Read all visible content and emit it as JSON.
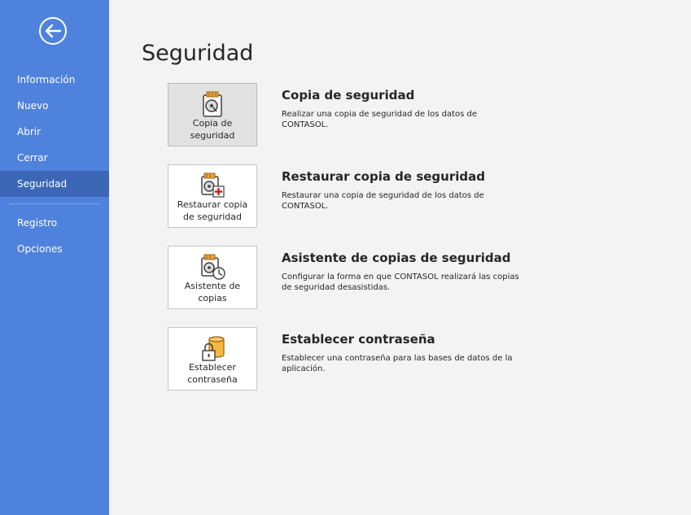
{
  "sidebar": {
    "back_icon": "back-arrow-icon",
    "items": [
      {
        "label": "Información"
      },
      {
        "label": "Nuevo"
      },
      {
        "label": "Abrir"
      },
      {
        "label": "Cerrar"
      },
      {
        "label": "Seguridad",
        "active": true
      },
      {
        "label": "Registro"
      },
      {
        "label": "Opciones"
      }
    ]
  },
  "main": {
    "title": "Seguridad",
    "options": [
      {
        "tile_line1": "Copia de",
        "tile_line2": "seguridad",
        "title": "Copia de seguridad",
        "desc_line1": "Realizar una copia de seguridad de los datos de",
        "desc_line2": "CONTASOL.",
        "icon": "backup-disk-icon"
      },
      {
        "tile_line1": "Restaurar copia",
        "tile_line2": "de seguridad",
        "title": "Restaurar copia de seguridad",
        "desc_line1": "Restaurar una copia de seguridad de los datos de",
        "desc_line2": "CONTASOL.",
        "icon": "restore-disk-icon"
      },
      {
        "tile_line1": "Asistente de",
        "tile_line2": "copias",
        "title": "Asistente de copias de seguridad",
        "desc_line1": "Configurar la forma en que CONTASOL realizará las copias",
        "desc_line2": "de seguridad desasistidas.",
        "icon": "backup-wizard-clock-icon"
      },
      {
        "tile_line1": "Establecer",
        "tile_line2": "contraseña",
        "title": "Establecer contraseña",
        "desc_line1": "Establecer una contraseña para las bases de datos de la",
        "desc_line2": "aplicación.",
        "icon": "lock-database-icon"
      }
    ]
  },
  "colors": {
    "sidebar": "#4f82dd",
    "sidebar_active": "#3b67b6",
    "background": "#f3f3f3"
  }
}
